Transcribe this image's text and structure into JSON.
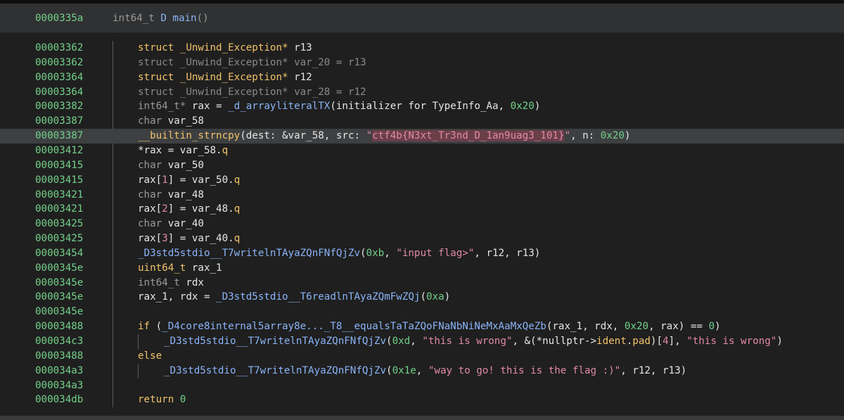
{
  "header": {
    "address": "0000335a",
    "signature_prefix": "int64_t ",
    "signature_fn": "D main",
    "signature_suffix": "()"
  },
  "lines": [
    {
      "addr": "00003362",
      "parts": [
        [
          "kw",
          "struct _Unwind_Exception* "
        ],
        [
          "var",
          "r13"
        ]
      ]
    },
    {
      "addr": "00003362",
      "parts": [
        [
          "mut",
          "struct _Unwind_Exception* var_20 = r13"
        ]
      ]
    },
    {
      "addr": "00003364",
      "parts": [
        [
          "kw",
          "struct _Unwind_Exception* "
        ],
        [
          "var",
          "r12"
        ]
      ]
    },
    {
      "addr": "00003364",
      "parts": [
        [
          "mut",
          "struct _Unwind_Exception* var_28 = r12"
        ]
      ]
    },
    {
      "addr": "00003382",
      "parts": [
        [
          "ty",
          "int64_t* "
        ],
        [
          "var",
          "rax = "
        ],
        [
          "fn",
          "_d_arrayliteralTX"
        ],
        [
          "var",
          "(initializer for TypeInfo_Aa, "
        ],
        [
          "num",
          "0x20"
        ],
        [
          "var",
          ")"
        ]
      ]
    },
    {
      "addr": "00003387",
      "parts": [
        [
          "ty",
          "char "
        ],
        [
          "var",
          "var_58"
        ]
      ]
    },
    {
      "addr": "00003387",
      "highlight": true,
      "parts": [
        [
          "kw",
          "__builtin_strncpy"
        ],
        [
          "var",
          "(dest: &var_58, src: "
        ],
        [
          "str",
          "\""
        ],
        [
          "flag",
          "ctf4b{N3xt_Tr3nd_D_1an9uag3_101}"
        ],
        [
          "str",
          "\""
        ],
        [
          "var",
          ", n: "
        ],
        [
          "num",
          "0x20"
        ],
        [
          "var",
          ")"
        ]
      ]
    },
    {
      "addr": "00003412",
      "parts": [
        [
          "var",
          "*rax = var_58."
        ],
        [
          "fld",
          "q"
        ]
      ]
    },
    {
      "addr": "00003415",
      "parts": [
        [
          "ty",
          "char "
        ],
        [
          "var",
          "var_50"
        ]
      ]
    },
    {
      "addr": "00003415",
      "parts": [
        [
          "var",
          "rax["
        ],
        [
          "br",
          "1"
        ],
        [
          "var",
          "] = var_50."
        ],
        [
          "fld",
          "q"
        ]
      ]
    },
    {
      "addr": "00003421",
      "parts": [
        [
          "ty",
          "char "
        ],
        [
          "var",
          "var_48"
        ]
      ]
    },
    {
      "addr": "00003421",
      "parts": [
        [
          "var",
          "rax["
        ],
        [
          "br",
          "2"
        ],
        [
          "var",
          "] = var_48."
        ],
        [
          "fld",
          "q"
        ]
      ]
    },
    {
      "addr": "00003425",
      "parts": [
        [
          "ty",
          "char "
        ],
        [
          "var",
          "var_40"
        ]
      ]
    },
    {
      "addr": "00003425",
      "parts": [
        [
          "var",
          "rax["
        ],
        [
          "br",
          "3"
        ],
        [
          "var",
          "] = var_40."
        ],
        [
          "fld",
          "q"
        ]
      ]
    },
    {
      "addr": "00003454",
      "parts": [
        [
          "fn",
          "_D3std5stdio__T7writelnTAyaZQnFNfQjZv"
        ],
        [
          "var",
          "("
        ],
        [
          "num",
          "0xb"
        ],
        [
          "var",
          ", "
        ],
        [
          "str",
          "\"input flag>\""
        ],
        [
          "var",
          ", r12, r13)"
        ]
      ]
    },
    {
      "addr": "0000345e",
      "parts": [
        [
          "kw",
          "uint64_t "
        ],
        [
          "var",
          "rax_1"
        ]
      ]
    },
    {
      "addr": "0000345e",
      "parts": [
        [
          "ty",
          "int64_t "
        ],
        [
          "var",
          "rdx"
        ]
      ]
    },
    {
      "addr": "0000345e",
      "parts": [
        [
          "var",
          "rax_1, rdx = "
        ],
        [
          "fn",
          "_D3std5stdio__T6readlnTAyaZQmFwZQj"
        ],
        [
          "var",
          "("
        ],
        [
          "num",
          "0xa"
        ],
        [
          "var",
          ")"
        ]
      ]
    },
    {
      "addr": "0000345e",
      "parts": []
    },
    {
      "addr": "00003488",
      "parts": [
        [
          "kw",
          "if "
        ],
        [
          "var",
          "("
        ],
        [
          "fn",
          "_D4core8internal5array8e..._T8__equalsTaTaZQoFNaNbNiNeMxAaMxQeZb"
        ],
        [
          "var",
          "(rax_1, rdx, "
        ],
        [
          "num",
          "0x20"
        ],
        [
          "var",
          ", rax) == "
        ],
        [
          "num",
          "0"
        ],
        [
          "var",
          ")"
        ]
      ]
    },
    {
      "addr": "000034c3",
      "indent": true,
      "parts": [
        [
          "fn",
          "_D3std5stdio__T7writelnTAyaZQnFNfQjZv"
        ],
        [
          "var",
          "("
        ],
        [
          "num",
          "0xd"
        ],
        [
          "var",
          ", "
        ],
        [
          "str",
          "\"this is wrong\""
        ],
        [
          "var",
          ", &(*nullptr->"
        ],
        [
          "fld",
          "ident"
        ],
        [
          "var",
          "."
        ],
        [
          "fld",
          "pad"
        ],
        [
          "var",
          ")["
        ],
        [
          "br",
          "4"
        ],
        [
          "var",
          "], "
        ],
        [
          "str",
          "\"this is wrong\""
        ],
        [
          "var",
          ")"
        ]
      ]
    },
    {
      "addr": "00003488",
      "parts": [
        [
          "kw",
          "else"
        ]
      ]
    },
    {
      "addr": "000034a3",
      "indent": true,
      "parts": [
        [
          "fn",
          "_D3std5stdio__T7writelnTAyaZQnFNfQjZv"
        ],
        [
          "var",
          "("
        ],
        [
          "num",
          "0x1e"
        ],
        [
          "var",
          ", "
        ],
        [
          "str",
          "\"way to go! this is the flag :)\""
        ],
        [
          "var",
          ", r12, r13)"
        ]
      ]
    },
    {
      "addr": "000034a3",
      "parts": []
    },
    {
      "addr": "000034db",
      "parts": [
        [
          "kw",
          "return "
        ],
        [
          "num",
          "0"
        ]
      ]
    }
  ]
}
